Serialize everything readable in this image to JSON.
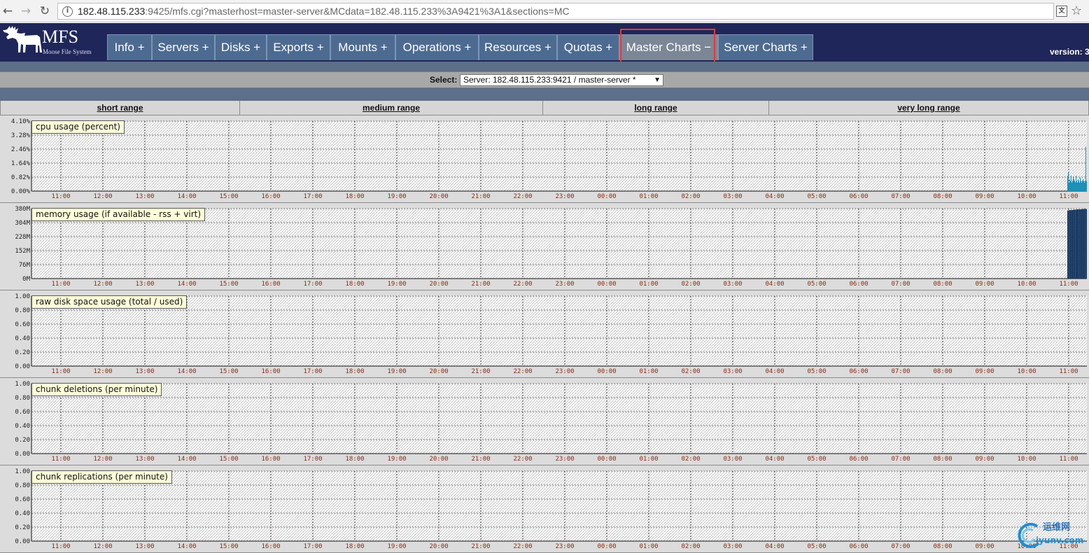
{
  "browser": {
    "url_host": "182.48.115.233",
    "url_rest": ":9425/mfs.cgi?masterhost=master-server&MCdata=182.48.115.233%3A9421%3A1&sections=MC"
  },
  "header": {
    "logo_title": "MFS",
    "logo_subtitle": "Moose File System",
    "version_label": "version: 3",
    "menu": [
      {
        "label": "Info +",
        "active": false
      },
      {
        "label": "Servers +",
        "active": false
      },
      {
        "label": "Disks +",
        "active": false
      },
      {
        "label": "Exports +",
        "active": false
      },
      {
        "label": "Mounts +",
        "active": false
      },
      {
        "label": "Operations +",
        "active": false
      },
      {
        "label": "Resources +",
        "active": false
      },
      {
        "label": "Quotas +",
        "active": false
      },
      {
        "label": "Master Charts −",
        "active": true
      },
      {
        "label": "Server Charts +",
        "active": false
      }
    ]
  },
  "select_bar": {
    "label": "Select:",
    "value": "Server: 182.48.115.233:9421 / master-server *"
  },
  "ranges": [
    "short range",
    "medium range",
    "long range",
    "very long range"
  ],
  "x_ticks": [
    "11:00",
    "12:00",
    "13:00",
    "14:00",
    "15:00",
    "16:00",
    "17:00",
    "18:00",
    "19:00",
    "20:00",
    "21:00",
    "22:00",
    "23:00",
    "00:00",
    "01:00",
    "02:00",
    "03:00",
    "04:00",
    "05:00",
    "06:00",
    "07:00",
    "08:00",
    "09:00",
    "10:00",
    "11:00"
  ],
  "charts": [
    {
      "title": "cpu usage (percent)",
      "y_ticks": [
        "0.00%",
        "0.82%",
        "1.64%",
        "2.46%",
        "3.28%",
        "4.10%"
      ],
      "y_max": 4.1,
      "series_color": "#1d8fb8",
      "series": [
        0.9,
        1.1,
        0.5,
        0.7,
        0.6,
        0.9,
        0.5,
        0.6,
        0.8,
        0.7,
        0.6,
        0.5,
        0.9,
        0.6,
        0.5,
        0.7,
        0.6,
        0.5,
        0.8,
        0.6,
        0.5,
        0.6,
        0.7,
        0.6,
        0.5,
        0.6,
        2.6,
        0.6
      ]
    },
    {
      "title": "memory usage (if available - rss + virt)",
      "y_ticks": [
        "0M",
        "76M",
        "152M",
        "228M",
        "304M",
        "380M"
      ],
      "y_max": 380,
      "series_color": "#1a3a63",
      "series": [
        370,
        372,
        373,
        374,
        375,
        376,
        376,
        377,
        378,
        378
      ]
    },
    {
      "title": "raw disk space usage (total / used)",
      "y_ticks": [
        "0.00",
        "0.20",
        "0.40",
        "0.60",
        "0.80",
        "1.00"
      ],
      "y_max": 1.0,
      "series_color": "#1d8fb8",
      "series": []
    },
    {
      "title": "chunk deletions (per minute)",
      "y_ticks": [
        "0.00",
        "0.20",
        "0.40",
        "0.60",
        "0.80",
        "1.00"
      ],
      "y_max": 1.0,
      "series_color": "#1d8fb8",
      "series": []
    },
    {
      "title": "chunk replications (per minute)",
      "y_ticks": [
        "0.00",
        "0.20",
        "0.40",
        "0.60",
        "0.80",
        "1.00"
      ],
      "y_max": 1.0,
      "series_color": "#1d8fb8",
      "series": []
    }
  ],
  "watermark": {
    "line1": "运维网",
    "line2": "iyunv.com"
  }
}
